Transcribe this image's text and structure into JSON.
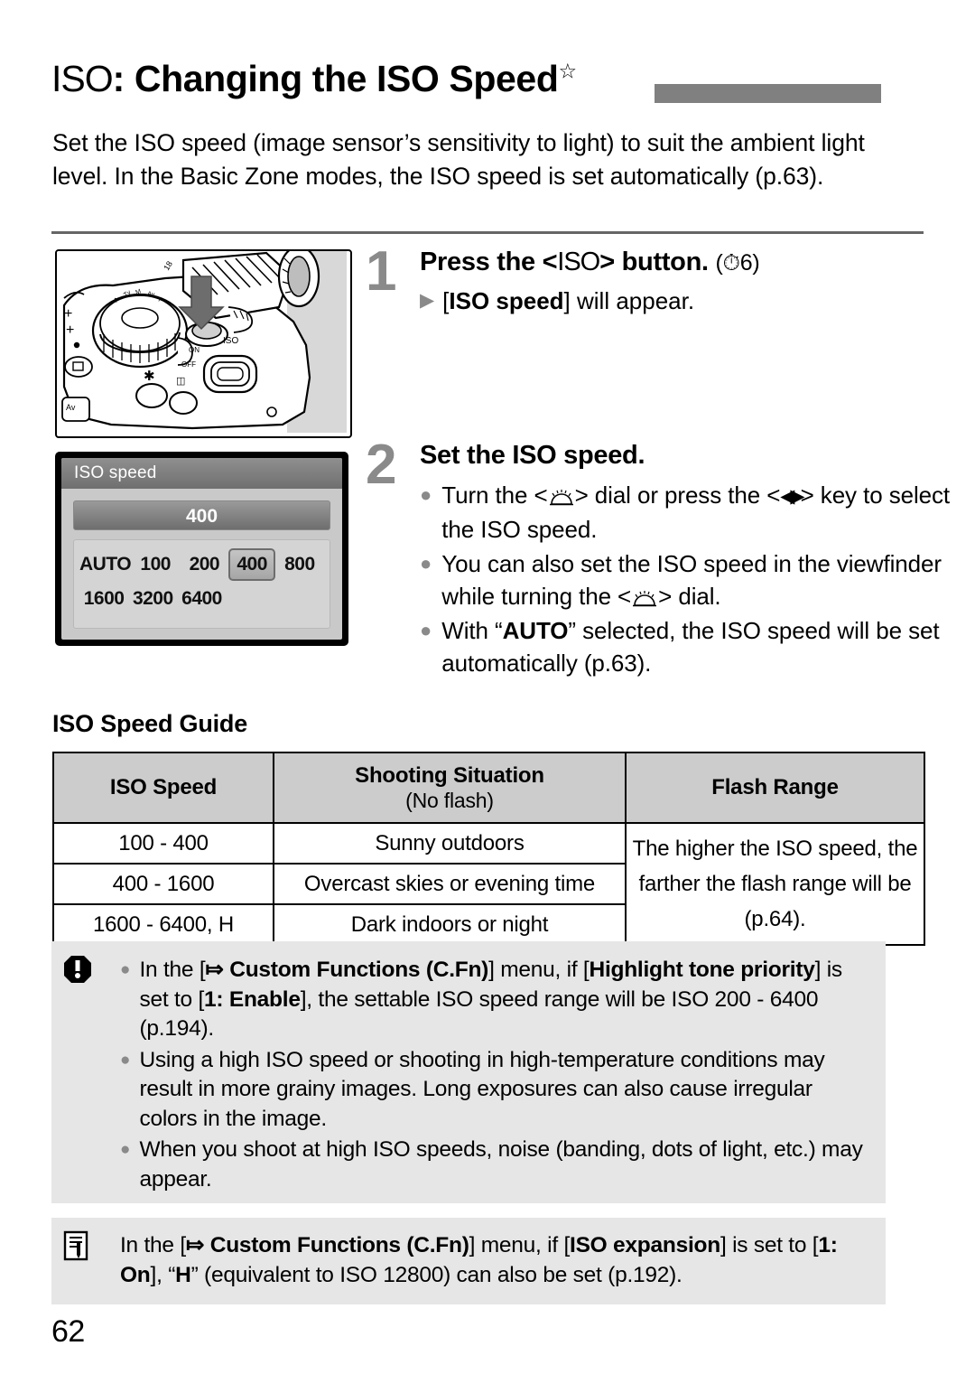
{
  "page": {
    "number": "62",
    "title_iso": "ISO",
    "title_colon": ": ",
    "title_main": "Changing the ISO Speed",
    "title_star": "☆",
    "intro": "Set the ISO speed (image sensor’s sensitivity to light) to suit the ambient light level. In the Basic Zone modes, the ISO speed is set automatically (p.63)."
  },
  "figures": {
    "camera": {
      "name": "camera-top-view-iso-button",
      "caption": ""
    },
    "lcd": {
      "header": "ISO speed",
      "current_value": "400",
      "grid_rows": [
        [
          "AUTO",
          "100",
          "200",
          "400",
          "800"
        ],
        [
          "1600",
          "3200",
          "6400",
          "",
          ""
        ]
      ],
      "selected": "400"
    }
  },
  "steps": [
    {
      "number": "1",
      "title_pre": "Press the <",
      "title_icon": "ISO",
      "title_post": "> button.",
      "title_note": "(⏱6)",
      "sub_bullets": [
        {
          "marker": "▶",
          "pre": "[",
          "bold": "ISO speed",
          "post": "] will appear."
        }
      ]
    },
    {
      "number": "2",
      "title": "Set the ISO speed.",
      "bullets": [
        "Turn the <⌘> dial or press the <◀▶> key to select the ISO speed.",
        "You can also set the ISO speed in the viewfinder while turning the <⌘> dial.",
        "With “AUTO” selected, the ISO speed will be set automatically (p.63)."
      ]
    }
  ],
  "guide": {
    "title": "ISO Speed Guide",
    "headers": {
      "col1": "ISO Speed",
      "col2_main": "Shooting Situation",
      "col2_sub": "(No flash)",
      "col3": "Flash Range"
    },
    "rows": [
      {
        "iso": "100 - 400",
        "situation": "Sunny outdoors"
      },
      {
        "iso": "400 - 1600",
        "situation": "Overcast skies or evening time"
      },
      {
        "iso": "1600 - 6400, H",
        "situation": "Dark indoors or night"
      }
    ],
    "flash_range_text": "The higher the ISO speed, the farther the flash range will be (p.64)."
  },
  "caution": {
    "icon": "warning-octagon-icon",
    "bullets": [
      {
        "segments": [
          {
            "t": "In the [",
            "b": false
          },
          {
            "t": "✇",
            "b": true
          },
          {
            "t": " Custom Functions (C.Fn)",
            "b": true
          },
          {
            "t": "] menu, if [",
            "b": false
          },
          {
            "t": "Highlight tone priority",
            "b": true
          },
          {
            "t": "] is set to [",
            "b": false
          },
          {
            "t": "1: Enable",
            "b": true
          },
          {
            "t": "], the settable ISO speed range will be ISO 200 - 6400 (p.194).",
            "b": false
          }
        ]
      },
      {
        "segments": [
          {
            "t": "Using a high ISO speed or shooting in high-temperature conditions may result in more grainy images. Long exposures can also cause irregular colors in the image.",
            "b": false
          }
        ]
      },
      {
        "segments": [
          {
            "t": "When you shoot at high ISO speeds, noise (banding, dots of light, etc.) may appear.",
            "b": false
          }
        ]
      }
    ]
  },
  "note": {
    "icon": "memo-note-icon",
    "segments": [
      {
        "t": "In the [",
        "b": false
      },
      {
        "t": "✇",
        "b": true
      },
      {
        "t": " Custom Functions (C.Fn)",
        "b": true
      },
      {
        "t": "] menu, if [",
        "b": false
      },
      {
        "t": "ISO expansion",
        "b": true
      },
      {
        "t": "] is set to [",
        "b": false
      },
      {
        "t": "1: On",
        "b": true
      },
      {
        "t": "], “",
        "b": false
      },
      {
        "t": "H",
        "b": true
      },
      {
        "t": "” (equivalent to ISO 12800) can also be set (p.192).",
        "b": false
      }
    ]
  },
  "colors": {
    "accent_gray": "#808080",
    "note_bg": "#e6e6e6",
    "table_header_bg": "#cccccc"
  }
}
